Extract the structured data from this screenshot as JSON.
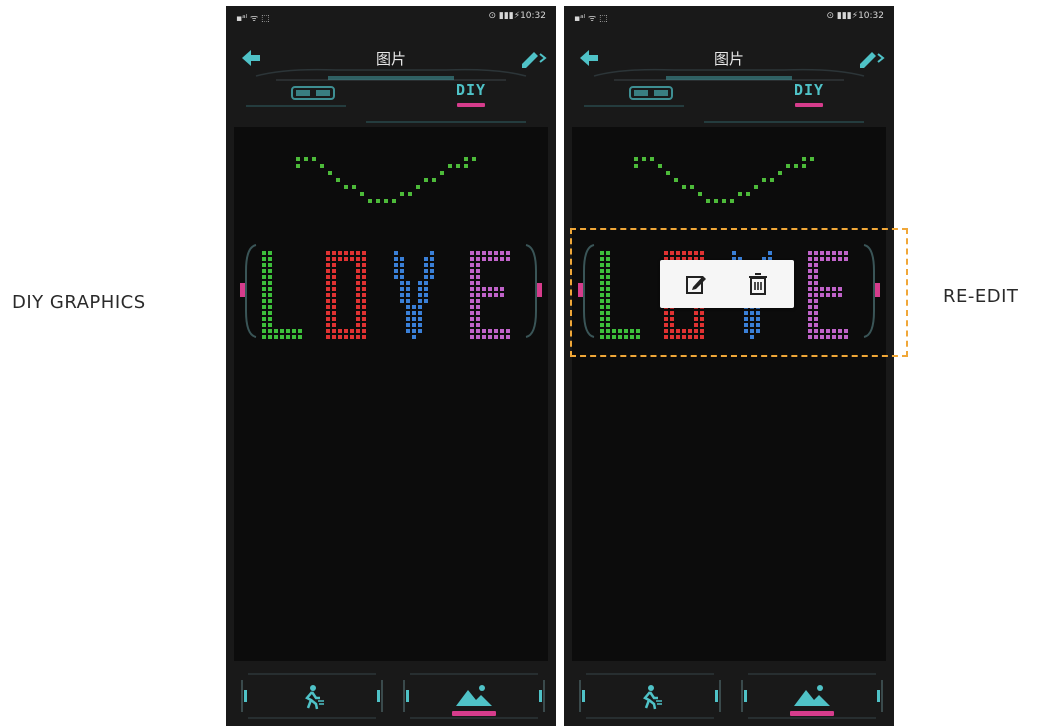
{
  "captions": {
    "left": "DIY GRAPHICS",
    "right": "RE-EDIT"
  },
  "phones": [
    {
      "status": {
        "left": "▪ᵃˡ ᯤ ⬚",
        "right": "⊙ ▮▮▮⚡10:32"
      },
      "title": "图片",
      "tabs": {
        "glasses_icon": "glasses-icon",
        "diy_label": "DIY",
        "active": "DIY"
      },
      "nav": {
        "run": "running-man-icon",
        "pictures": "mountain-picture-icon",
        "active": "pictures"
      },
      "popup": null
    },
    {
      "status": {
        "left": "▪ᵃˡ ᯤ ⬚",
        "right": "⊙ ▮▮▮⚡10:32"
      },
      "title": "图片",
      "tabs": {
        "glasses_icon": "glasses-icon",
        "diy_label": "DIY",
        "active": "DIY"
      },
      "nav": {
        "run": "running-man-icon",
        "pictures": "mountain-picture-icon",
        "active": "pictures"
      },
      "popup": {
        "actions": [
          "edit-icon",
          "trash-icon"
        ]
      }
    }
  ],
  "colors": {
    "accent": "#4fc2c7",
    "active_underline": "#d63c8c",
    "screen_bg": "#0c0c0c",
    "phone_bg": "#191919",
    "highlight_border": "#f0a738",
    "pixel_wave": "#4dbb3a",
    "pixel_L": "#3dbf3b",
    "pixel_O": "#e03232",
    "pixel_V": "#3a80d8",
    "pixel_E": "#c063c9"
  },
  "graphic": {
    "word": [
      "L",
      "O",
      "V",
      "E"
    ]
  }
}
